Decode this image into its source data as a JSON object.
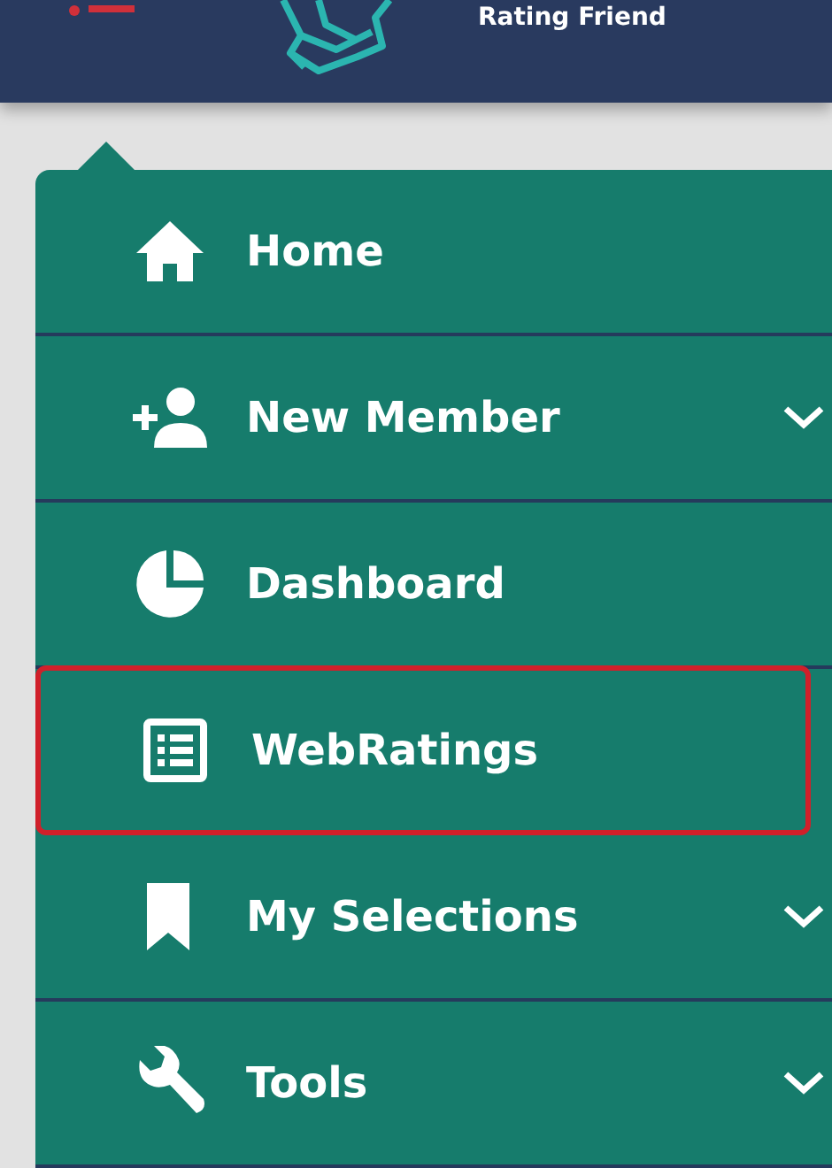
{
  "header": {
    "title": "Rating Friend"
  },
  "menu": {
    "items": [
      {
        "label": "Home",
        "has_submenu": false,
        "selected": false
      },
      {
        "label": "New Member",
        "has_submenu": true,
        "selected": false
      },
      {
        "label": "Dashboard",
        "has_submenu": false,
        "selected": false
      },
      {
        "label": "WebRatings",
        "has_submenu": false,
        "selected": true
      },
      {
        "label": "My Selections",
        "has_submenu": true,
        "selected": false
      },
      {
        "label": "Tools",
        "has_submenu": true,
        "selected": false
      }
    ]
  }
}
